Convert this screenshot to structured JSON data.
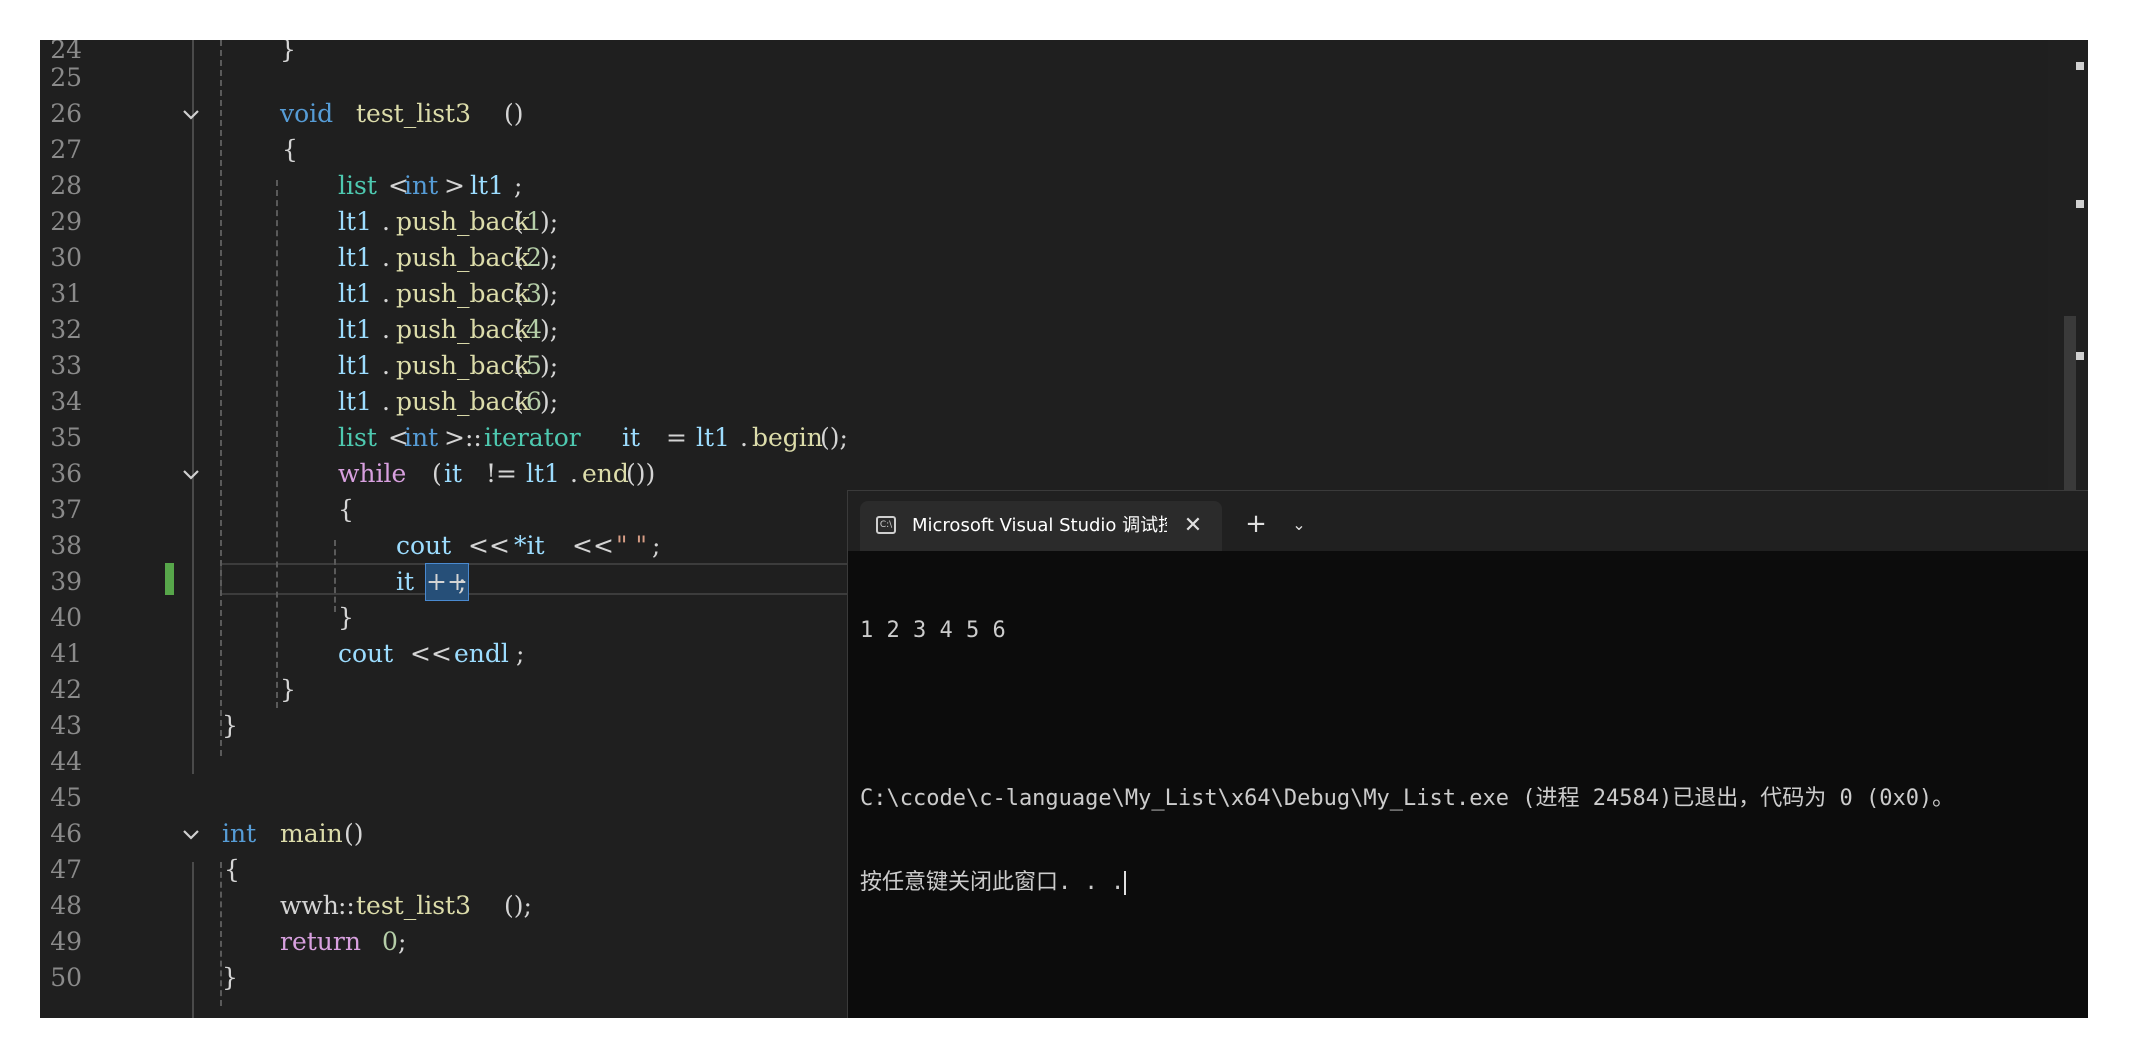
{
  "editor": {
    "lines": [
      {
        "n": "24"
      },
      {
        "n": "25"
      },
      {
        "n": "26"
      },
      {
        "n": "27"
      },
      {
        "n": "28"
      },
      {
        "n": "29"
      },
      {
        "n": "30"
      },
      {
        "n": "31"
      },
      {
        "n": "32"
      },
      {
        "n": "33"
      },
      {
        "n": "34"
      },
      {
        "n": "35"
      },
      {
        "n": "36"
      },
      {
        "n": "37"
      },
      {
        "n": "38"
      },
      {
        "n": "39"
      },
      {
        "n": "40"
      },
      {
        "n": "41"
      },
      {
        "n": "42"
      },
      {
        "n": "43"
      },
      {
        "n": "44"
      },
      {
        "n": "45"
      },
      {
        "n": "46"
      },
      {
        "n": "47"
      },
      {
        "n": "48"
      },
      {
        "n": "49"
      },
      {
        "n": "50"
      }
    ],
    "tokens": {
      "l24": "}",
      "l26_kw": "void",
      "l26_fn": "test_list3",
      "l26_p": "()",
      "l27": "{",
      "l28_ty": "list",
      "l28_lt": "<",
      "l28_int": "int",
      "l28_gt": ">",
      "l28_var": "lt1",
      "l28_end": ";",
      "pb_var": "lt1",
      "pb_dot": ".",
      "pb_fn": "push_back",
      "pb_open": "(",
      "pb_close": ");",
      "v1": "1",
      "v2": "2",
      "v3": "3",
      "v4": "4",
      "v5": "5",
      "v6": "6",
      "l35_ty": "list",
      "l35_lt": "<",
      "l35_int": "int",
      "l35_gt": ">::",
      "l35_it": "iterator",
      "l35_var": "it",
      "l35_eq": "=",
      "l35_obj": "lt1",
      "l35_dot": ".",
      "l35_fn": "begin",
      "l35_end": "();",
      "l36_kw": "while",
      "l36_p1": "(",
      "l36_it": "it",
      "l36_ne": "!=",
      "l36_obj": "lt1",
      "l36_dot": ".",
      "l36_fn": "end",
      "l36_p2": "())",
      "l37": "{",
      "l38_cout": "cout",
      "l38_op1": "<<",
      "l38_deref": "*it",
      "l38_op2": "<<",
      "l38_str": "\" \"",
      "l38_end": ";",
      "l39_it": "it",
      "l39_pp": "++",
      "l39_end": ";",
      "l40": "}",
      "l41_cout": "cout",
      "l41_op": "<<",
      "l41_endl": "endl",
      "l41_end": ";",
      "l42": "}",
      "l43": "}",
      "l46_kw": "int",
      "l46_fn": "main",
      "l46_p": "()",
      "l47": "{",
      "l48_ns": "wwh",
      "l48_sc": "::",
      "l48_fn": "test_list3",
      "l48_end": "();",
      "l49_kw": "return",
      "l49_num": "0",
      "l49_end": ";",
      "l50": "}"
    }
  },
  "terminal": {
    "tab_title": "Microsoft Visual Studio 调试控",
    "tab_icon_text": "C:\\",
    "close_glyph": "✕",
    "new_tab_glyph": "+",
    "dropdown_glyph": "⌄",
    "output": [
      "1 2 3 4 5 6",
      "",
      "C:\\ccode\\c-language\\My_List\\x64\\Debug\\My_List.exe (进程 24584)已退出，代码为 0 (0x0)。",
      "按任意键关闭此窗口. . ."
    ]
  },
  "colors": {
    "editor_bg": "#1f1f1f",
    "keyword": "#569cd6",
    "control_keyword": "#d8a0df",
    "type": "#4ec9b0",
    "function": "#dcdcaa",
    "variable": "#9cdcfe",
    "number": "#b5cea8",
    "string": "#d69d85",
    "changed_line_marker": "#57a64a",
    "terminal_bg": "#0c0c0c"
  }
}
